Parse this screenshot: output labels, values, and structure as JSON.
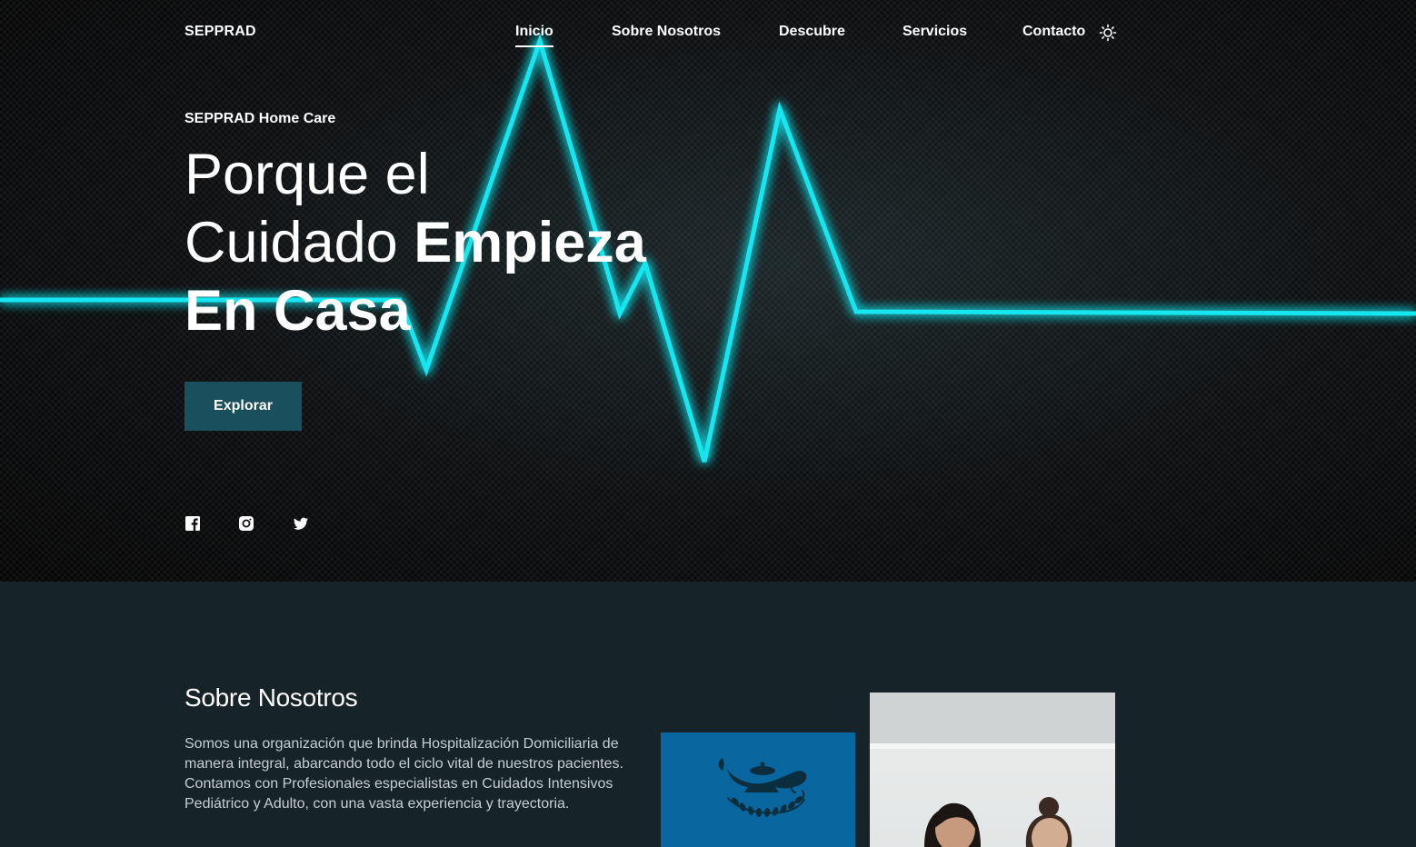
{
  "nav": {
    "brand": "SEPPRAD",
    "links": [
      {
        "label": "Inicio",
        "active": true
      },
      {
        "label": "Sobre Nosotros",
        "active": false
      },
      {
        "label": "Descubre",
        "active": false
      },
      {
        "label": "Servicios",
        "active": false
      },
      {
        "label": "Contacto",
        "active": false
      }
    ],
    "theme_toggle_icon": "sun-icon"
  },
  "hero": {
    "eyebrow": "SEPPRAD Home Care",
    "headline": {
      "line1": "Porque el",
      "line2_light": "Cuidado ",
      "line2_bold": "Empieza",
      "line3_bold": "En Casa"
    },
    "cta_label": "Explorar",
    "social_icons": [
      "facebook-icon",
      "instagram-icon",
      "twitter-icon"
    ],
    "pulse_color": "#19e6f0"
  },
  "about": {
    "title": "Sobre Nosotros",
    "text": "Somos una organización que brinda Hospitalización Domiciliaria de manera integral, abarcando todo el ciclo vital de nuestros pacientes. Contamos con Profesionales especialistas en Cuidados Intensivos Pediátrico y Adulto, con una vasta experiencia y trayectoria.",
    "logo_bg": "#09669f",
    "logo_icon": "nurse-lamp-icon"
  },
  "colors": {
    "button_bg": "#1a4f5e",
    "section_bg": "#162329"
  }
}
